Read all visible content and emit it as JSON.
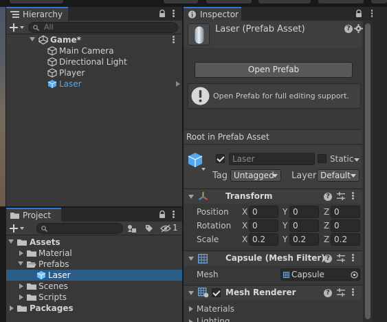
{
  "hierarchy": {
    "tab_label": "Hierarchy",
    "search_placeholder": "All",
    "scene_name": "Game*",
    "items": [
      {
        "label": "Main Camera"
      },
      {
        "label": "Directional Light"
      },
      {
        "label": "Player"
      },
      {
        "label": "Laser",
        "selected_text": true
      }
    ]
  },
  "project": {
    "tab_label": "Project",
    "hidden_count": "1",
    "tree": [
      {
        "label": "Assets"
      },
      {
        "label": "Material"
      },
      {
        "label": "Prefabs"
      },
      {
        "label": "Laser",
        "selected": true
      },
      {
        "label": "Scenes"
      },
      {
        "label": "Scripts"
      },
      {
        "label": "Packages"
      }
    ]
  },
  "inspector": {
    "tab_label": "Inspector",
    "asset_title": "Laser (Prefab Asset)",
    "open_prefab_button": "Open Prefab",
    "info_message": "Open Prefab for full editing support.",
    "root_label": "Root in Prefab Asset",
    "object_name": "Laser",
    "active": true,
    "static_label": "Static",
    "tag_label": "Tag",
    "tag_value": "Untagged",
    "layer_label": "Layer",
    "layer_value": "Default",
    "transform": {
      "title": "Transform",
      "rows": [
        {
          "label": "Position",
          "x": "0",
          "y": "0",
          "z": "0"
        },
        {
          "label": "Rotation",
          "x": "0",
          "y": "0",
          "z": "0"
        },
        {
          "label": "Scale",
          "x": "0.2",
          "y": "0.2",
          "z": "0.2"
        }
      ],
      "axis_x": "X",
      "axis_y": "Y",
      "axis_z": "Z"
    },
    "mesh_filter": {
      "title": "Capsule (Mesh Filter)",
      "mesh_label": "Mesh",
      "mesh_value": "Capsule"
    },
    "mesh_renderer": {
      "title": "Mesh Renderer",
      "enabled": true,
      "materials_label": "Materials",
      "lighting_label": "Lighting"
    }
  },
  "colors": {
    "accent_blue": "#2b7ad6",
    "selection": "#2c5d87",
    "panel": "#383838",
    "laser_text": "#4fa8f0"
  },
  "icons": [
    "lock-icon",
    "kebab-menu-icon",
    "plus-icon",
    "search-icon",
    "unity-scene-icon",
    "gameobject-cube-icon",
    "prefab-cube-icon",
    "folder-icon",
    "help-icon",
    "settings-icon",
    "info-icon",
    "transform-axes-icon",
    "mesh-filter-grid-icon",
    "mesh-renderer-icon",
    "sliders-icon",
    "eye-hidden-icon",
    "tag-icon",
    "filter-icon"
  ]
}
